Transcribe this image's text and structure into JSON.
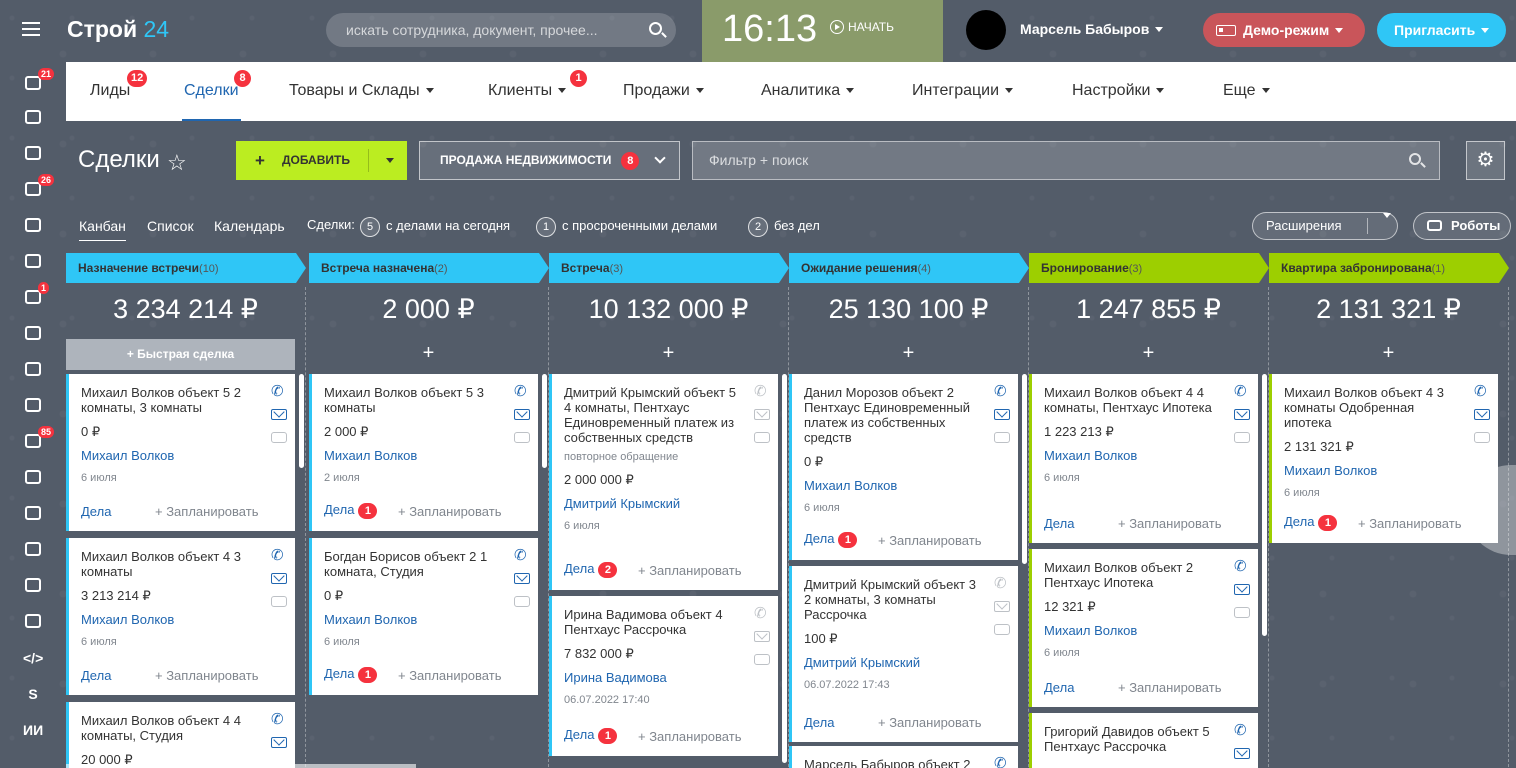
{
  "app": {
    "logo_main": "Строй",
    "logo_num": "24"
  },
  "search": {
    "placeholder": "искать сотрудника, документ, прочее..."
  },
  "clock": {
    "time": "16:13",
    "start_label": "НАЧАТЬ"
  },
  "user": {
    "name": "Марсель Бабыров"
  },
  "demo_label": "Демо-режим",
  "invite_label": "Пригласить",
  "sidebar": [
    {
      "name": "filter-icon",
      "badge": "21"
    },
    {
      "name": "target-icon",
      "badge": ""
    },
    {
      "name": "cart-icon",
      "badge": ""
    },
    {
      "name": "tasks-icon",
      "badge": "26"
    },
    {
      "name": "sites-icon",
      "badge": ""
    },
    {
      "name": "document-icon",
      "badge": ""
    },
    {
      "name": "chat-icon",
      "badge": "1"
    },
    {
      "name": "calendar-icon",
      "badge": ""
    },
    {
      "name": "file-icon",
      "badge": ""
    },
    {
      "name": "inbox-icon",
      "badge": ""
    },
    {
      "name": "mail-icon",
      "badge": "85"
    },
    {
      "name": "team-icon",
      "badge": ""
    },
    {
      "name": "contact-card-icon",
      "badge": ""
    },
    {
      "name": "robot-icon",
      "badge": ""
    },
    {
      "name": "box-icon",
      "badge": ""
    },
    {
      "name": "box2-icon",
      "badge": ""
    },
    {
      "name": "code-icon",
      "badge": "",
      "text": "</>"
    },
    {
      "name": "s-icon",
      "badge": "",
      "text": "S"
    },
    {
      "name": "ii-icon",
      "badge": "",
      "text": "ИИ"
    }
  ],
  "tabs": [
    {
      "label": "Лиды",
      "badge": "12"
    },
    {
      "label": "Сделки",
      "badge": "8",
      "active": true
    },
    {
      "label": "Товары и Склады",
      "badge": ""
    },
    {
      "label": "Клиенты",
      "badge": "1"
    },
    {
      "label": "Продажи",
      "badge": ""
    },
    {
      "label": "Аналитика",
      "badge": ""
    },
    {
      "label": "Интеграции",
      "badge": ""
    },
    {
      "label": "Настройки",
      "badge": ""
    },
    {
      "label": "Еще",
      "badge": ""
    }
  ],
  "page": {
    "title": "Сделки",
    "add_label": "ДОБАВИТЬ",
    "category": "ПРОДАЖА НЕДВИЖИМОСТИ",
    "category_badge": "8",
    "filter_placeholder": "Фильтр + поиск"
  },
  "views": {
    "kanban": "Канбан",
    "list": "Список",
    "calendar": "Календарь"
  },
  "counters": {
    "label": "Сделки:",
    "today_n": "5",
    "today": "с делами на сегодня",
    "overdue_n": "1",
    "overdue": "с просроченными делами",
    "none_n": "2",
    "none": "без дел"
  },
  "extensions_label": "Расширения",
  "robots_label": "Роботы",
  "quick_deal": "Быстрая сделка",
  "columns": [
    {
      "title": "Назначение встречи",
      "count": "(10)",
      "sum": "3 234 214 ₽",
      "color": "#2fc6f6",
      "cards": [
        {
          "title": "Михаил Волков объект 5 2 комнаты, 3 комнаты",
          "price": "0 ₽",
          "person": "Михаил Волков",
          "date": "6 июля",
          "deals": "Дела",
          "deals_badge": "",
          "plan": "+ Запланировать"
        },
        {
          "title": "Михаил Волков объект 4 3 комнаты",
          "price": "3 213 214 ₽",
          "person": "Михаил Волков",
          "date": "6 июля",
          "deals": "Дела",
          "deals_badge": "",
          "plan": "+ Запланировать"
        },
        {
          "title": "Михаил Волков объект 4 4 комнаты, Студия",
          "price": "20 000 ₽",
          "person": "",
          "date": "",
          "deals": "",
          "deals_badge": "",
          "plan": ""
        }
      ]
    },
    {
      "title": "Встреча назначена",
      "count": "(2)",
      "sum": "2 000 ₽",
      "color": "#2fc6f6",
      "cards": [
        {
          "title": "Михаил Волков объект 5 3 комнаты",
          "price": "2 000 ₽",
          "person": "Михаил Волков",
          "date": "2 июля",
          "deals": "Дела",
          "deals_badge": "1",
          "plan": "+ Запланировать"
        },
        {
          "title": "Богдан Борисов объект 2 1 комната, Студия",
          "price": "0 ₽",
          "person": "Михаил Волков",
          "date": "6 июля",
          "deals": "Дела",
          "deals_badge": "1",
          "plan": "+ Запланировать"
        }
      ]
    },
    {
      "title": "Встреча",
      "count": "(3)",
      "sum": "10 132 000 ₽",
      "color": "#2fc6f6",
      "cards": [
        {
          "title": "Дмитрий Крымский объект 5 4 комнаты, Пентхаус Единовременный платеж из собственных средств",
          "note": "повторное обращение",
          "price": "2 000 000 ₽",
          "person": "Дмитрий Крымский",
          "date": "6 июля",
          "deals": "Дела",
          "deals_badge": "2",
          "plan": "+ Запланировать"
        },
        {
          "title": "Ирина Вадимова объект 4 Пентхаус Рассрочка",
          "price": "7 832 000 ₽",
          "person": "Ирина Вадимова",
          "date": "06.07.2022 17:40",
          "deals": "Дела",
          "deals_badge": "1",
          "plan": "+ Запланировать"
        }
      ]
    },
    {
      "title": "Ожидание решения",
      "count": "(4)",
      "sum": "25 130 100 ₽",
      "color": "#2fc6f6",
      "cards": [
        {
          "title": "Данил Морозов объект 2 Пентхаус Единовременный платеж из собственных средств",
          "price": "0 ₽",
          "person": "Михаил Волков",
          "date": "6 июля",
          "deals": "Дела",
          "deals_badge": "1",
          "plan": "+ Запланировать"
        },
        {
          "title": "Дмитрий Крымский объект 3 2 комнаты, 3 комнаты Рассрочка",
          "price": "100 ₽",
          "person": "Дмитрий Крымский",
          "date": "06.07.2022 17:43",
          "deals": "Дела",
          "deals_badge": "",
          "plan": "+ Запланировать"
        },
        {
          "title": "Марсель Бабыров объект 2",
          "price": "",
          "person": "",
          "date": "",
          "deals": "",
          "deals_badge": "",
          "plan": ""
        }
      ]
    },
    {
      "title": "Бронирование",
      "count": "(3)",
      "sum": "1 247 855 ₽",
      "color": "#9dcf00",
      "cards": [
        {
          "title": "Михаил Волков объект 4 4 комнаты, Пентхаус Ипотека",
          "price": "1 223 213 ₽",
          "person": "Михаил Волков",
          "date": "6 июля",
          "deals": "Дела",
          "deals_badge": "",
          "plan": "+ Запланировать"
        },
        {
          "title": "Михаил Волков объект 2 Пентхаус Ипотека",
          "price": "12 321 ₽",
          "person": "Михаил Волков",
          "date": "6 июля",
          "deals": "Дела",
          "deals_badge": "",
          "plan": "+ Запланировать"
        },
        {
          "title": "Григорий Давидов объект 5 Пентхаус Рассрочка",
          "price": "",
          "person": "",
          "date": "",
          "deals": "",
          "deals_badge": "",
          "plan": ""
        }
      ]
    },
    {
      "title": "Квартира забронирована",
      "count": "(1)",
      "sum": "2 131 321 ₽",
      "color": "#9dcf00",
      "cards": [
        {
          "title": "Михаил Волков объект 4 3 комнаты Одобренная ипотека",
          "price": "2 131 321 ₽",
          "person": "Михаил Волков",
          "date": "6 июля",
          "deals": "Дела",
          "deals_badge": "1",
          "plan": "+ Запланировать"
        }
      ]
    }
  ]
}
